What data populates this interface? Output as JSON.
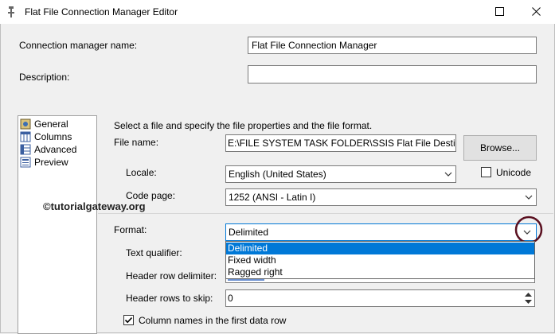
{
  "window": {
    "title": "Flat File Connection Manager Editor"
  },
  "connection_manager_name": {
    "label": "Connection manager name:",
    "value": "Flat File Connection Manager"
  },
  "description": {
    "label": "Description:",
    "value": ""
  },
  "nav": {
    "items": [
      {
        "label": "General",
        "icon": "general-icon"
      },
      {
        "label": "Columns",
        "icon": "columns-icon"
      },
      {
        "label": "Advanced",
        "icon": "advanced-icon"
      },
      {
        "label": "Preview",
        "icon": "preview-icon"
      }
    ]
  },
  "general": {
    "instruction": "Select a file and specify the file properties and the file format.",
    "file_name_label": "File name:",
    "file_name_value": "E:\\FILE SYSTEM TASK FOLDER\\SSIS Flat File Destination",
    "browse_label": "Browse...",
    "locale_label": "Locale:",
    "locale_value": "English (United States)",
    "unicode_label": "Unicode",
    "unicode_checked": false,
    "code_page_label": "Code page:",
    "code_page_value": "1252  (ANSI - Latin I)",
    "watermark": "©tutorialgateway.org",
    "format_label": "Format:",
    "format_value": "Delimited",
    "format_options": [
      "Delimited",
      "Fixed width",
      "Ragged right"
    ],
    "text_qualifier_label": "Text qualifier:",
    "header_row_delimiter_label": "Header row delimiter:",
    "header_rows_to_skip_label": "Header rows to skip:",
    "header_rows_to_skip_value": "0",
    "column_names_label": "Column names in the first data row",
    "column_names_checked": true
  },
  "colors": {
    "selection": "#0078d7",
    "annotation_circle": "#5a1020",
    "watermark": "#222222"
  }
}
